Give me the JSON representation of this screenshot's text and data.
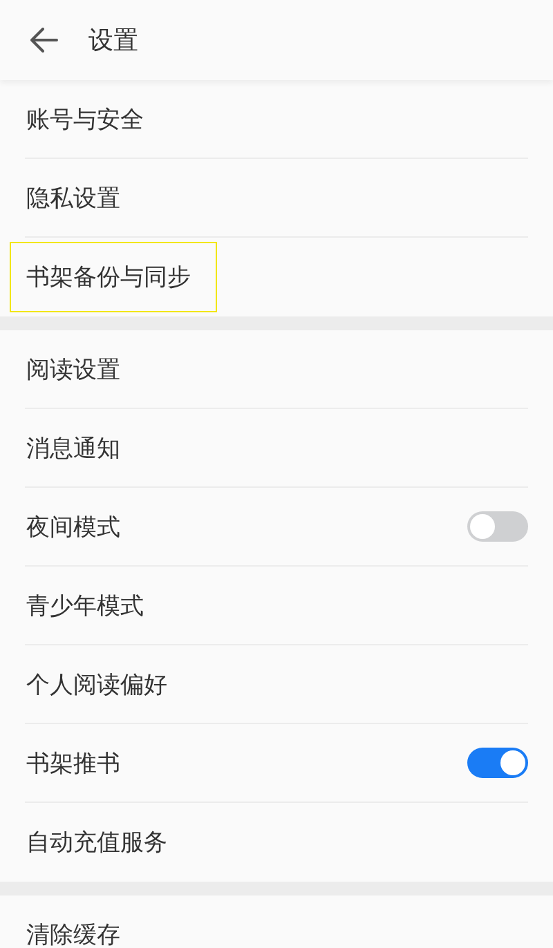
{
  "header": {
    "title": "设置"
  },
  "groups": [
    {
      "items": [
        {
          "label": "账号与安全",
          "kind": "link",
          "highlighted": false
        },
        {
          "label": "隐私设置",
          "kind": "link",
          "highlighted": false
        },
        {
          "label": "书架备份与同步",
          "kind": "link",
          "highlighted": true
        }
      ]
    },
    {
      "items": [
        {
          "label": "阅读设置",
          "kind": "link",
          "highlighted": false
        },
        {
          "label": "消息通知",
          "kind": "link",
          "highlighted": false
        },
        {
          "label": "夜间模式",
          "kind": "toggle",
          "on": false,
          "highlighted": false
        },
        {
          "label": "青少年模式",
          "kind": "link",
          "highlighted": false
        },
        {
          "label": "个人阅读偏好",
          "kind": "link",
          "highlighted": false
        },
        {
          "label": "书架推书",
          "kind": "toggle",
          "on": true,
          "highlighted": false
        },
        {
          "label": "自动充值服务",
          "kind": "link",
          "highlighted": false
        }
      ]
    },
    {
      "items": [
        {
          "label": "清除缓存",
          "kind": "link",
          "highlighted": false
        }
      ]
    }
  ]
}
